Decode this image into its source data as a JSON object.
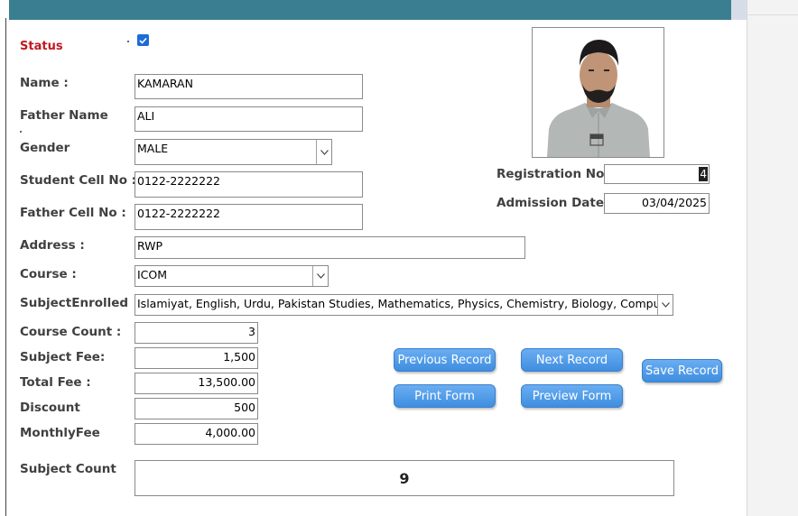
{
  "form": {
    "status_label": "Status",
    "status_checked": true,
    "fields": {
      "name": {
        "label": "Name :",
        "value": "KAMARAN"
      },
      "father_name": {
        "label": "Father Name",
        "value": "ALI"
      },
      "gender": {
        "label": "Gender",
        "value": "MALE"
      },
      "student_cell": {
        "label": "Student Cell No :",
        "value": "0122-2222222"
      },
      "father_cell": {
        "label": "Father Cell No :",
        "value": "0122-2222222"
      },
      "address": {
        "label": "Address :",
        "value": "RWP"
      },
      "course": {
        "label": "Course :",
        "value": "ICOM"
      },
      "subjects_enrolled": {
        "label": "SubjectEnrolled",
        "value": "Islamiyat, English, Urdu, Pakistan Studies, Mathematics, Physics, Chemistry, Biology, Computer Science"
      },
      "course_count": {
        "label": "Course Count :",
        "value": "3"
      },
      "subject_fee": {
        "label": "Subject Fee:",
        "value": "1,500"
      },
      "total_fee": {
        "label": "Total Fee :",
        "value": "13,500.00"
      },
      "discount": {
        "label": "Discount",
        "value": "500"
      },
      "monthly_fee": {
        "label": "MonthlyFee",
        "value": "4,000.00"
      },
      "registration_no": {
        "label": "Registration No",
        "value": "4"
      },
      "admission_date": {
        "label": "Admission Date",
        "value": "03/04/2025"
      }
    },
    "subject_count": {
      "label": "Subject Count",
      "value": "9"
    },
    "buttons": {
      "previous": "Previous Record",
      "next": "Next Record",
      "save": "Save Record",
      "print": "Print Form",
      "preview": "Preview Form"
    },
    "colors": {
      "title_bar": "#3a7f91",
      "status_label": "#c0191f",
      "button": "#4a96e6",
      "checkbox": "#1e6bd6"
    },
    "icons": [
      "check-icon",
      "chevron-down-icon",
      "student-photo"
    ]
  }
}
